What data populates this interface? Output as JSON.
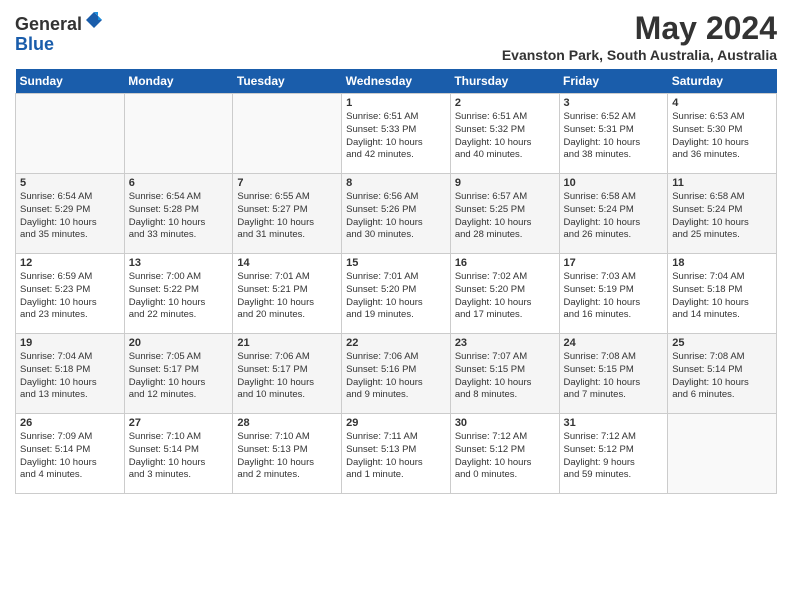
{
  "header": {
    "logo_line1": "General",
    "logo_line2": "Blue",
    "title": "May 2024",
    "subtitle": "Evanston Park, South Australia, Australia"
  },
  "days_of_week": [
    "Sunday",
    "Monday",
    "Tuesday",
    "Wednesday",
    "Thursday",
    "Friday",
    "Saturday"
  ],
  "weeks": [
    [
      {
        "day": "",
        "info": ""
      },
      {
        "day": "",
        "info": ""
      },
      {
        "day": "",
        "info": ""
      },
      {
        "day": "1",
        "info": "Sunrise: 6:51 AM\nSunset: 5:33 PM\nDaylight: 10 hours\nand 42 minutes."
      },
      {
        "day": "2",
        "info": "Sunrise: 6:51 AM\nSunset: 5:32 PM\nDaylight: 10 hours\nand 40 minutes."
      },
      {
        "day": "3",
        "info": "Sunrise: 6:52 AM\nSunset: 5:31 PM\nDaylight: 10 hours\nand 38 minutes."
      },
      {
        "day": "4",
        "info": "Sunrise: 6:53 AM\nSunset: 5:30 PM\nDaylight: 10 hours\nand 36 minutes."
      }
    ],
    [
      {
        "day": "5",
        "info": "Sunrise: 6:54 AM\nSunset: 5:29 PM\nDaylight: 10 hours\nand 35 minutes."
      },
      {
        "day": "6",
        "info": "Sunrise: 6:54 AM\nSunset: 5:28 PM\nDaylight: 10 hours\nand 33 minutes."
      },
      {
        "day": "7",
        "info": "Sunrise: 6:55 AM\nSunset: 5:27 PM\nDaylight: 10 hours\nand 31 minutes."
      },
      {
        "day": "8",
        "info": "Sunrise: 6:56 AM\nSunset: 5:26 PM\nDaylight: 10 hours\nand 30 minutes."
      },
      {
        "day": "9",
        "info": "Sunrise: 6:57 AM\nSunset: 5:25 PM\nDaylight: 10 hours\nand 28 minutes."
      },
      {
        "day": "10",
        "info": "Sunrise: 6:58 AM\nSunset: 5:24 PM\nDaylight: 10 hours\nand 26 minutes."
      },
      {
        "day": "11",
        "info": "Sunrise: 6:58 AM\nSunset: 5:24 PM\nDaylight: 10 hours\nand 25 minutes."
      }
    ],
    [
      {
        "day": "12",
        "info": "Sunrise: 6:59 AM\nSunset: 5:23 PM\nDaylight: 10 hours\nand 23 minutes."
      },
      {
        "day": "13",
        "info": "Sunrise: 7:00 AM\nSunset: 5:22 PM\nDaylight: 10 hours\nand 22 minutes."
      },
      {
        "day": "14",
        "info": "Sunrise: 7:01 AM\nSunset: 5:21 PM\nDaylight: 10 hours\nand 20 minutes."
      },
      {
        "day": "15",
        "info": "Sunrise: 7:01 AM\nSunset: 5:20 PM\nDaylight: 10 hours\nand 19 minutes."
      },
      {
        "day": "16",
        "info": "Sunrise: 7:02 AM\nSunset: 5:20 PM\nDaylight: 10 hours\nand 17 minutes."
      },
      {
        "day": "17",
        "info": "Sunrise: 7:03 AM\nSunset: 5:19 PM\nDaylight: 10 hours\nand 16 minutes."
      },
      {
        "day": "18",
        "info": "Sunrise: 7:04 AM\nSunset: 5:18 PM\nDaylight: 10 hours\nand 14 minutes."
      }
    ],
    [
      {
        "day": "19",
        "info": "Sunrise: 7:04 AM\nSunset: 5:18 PM\nDaylight: 10 hours\nand 13 minutes."
      },
      {
        "day": "20",
        "info": "Sunrise: 7:05 AM\nSunset: 5:17 PM\nDaylight: 10 hours\nand 12 minutes."
      },
      {
        "day": "21",
        "info": "Sunrise: 7:06 AM\nSunset: 5:17 PM\nDaylight: 10 hours\nand 10 minutes."
      },
      {
        "day": "22",
        "info": "Sunrise: 7:06 AM\nSunset: 5:16 PM\nDaylight: 10 hours\nand 9 minutes."
      },
      {
        "day": "23",
        "info": "Sunrise: 7:07 AM\nSunset: 5:15 PM\nDaylight: 10 hours\nand 8 minutes."
      },
      {
        "day": "24",
        "info": "Sunrise: 7:08 AM\nSunset: 5:15 PM\nDaylight: 10 hours\nand 7 minutes."
      },
      {
        "day": "25",
        "info": "Sunrise: 7:08 AM\nSunset: 5:14 PM\nDaylight: 10 hours\nand 6 minutes."
      }
    ],
    [
      {
        "day": "26",
        "info": "Sunrise: 7:09 AM\nSunset: 5:14 PM\nDaylight: 10 hours\nand 4 minutes."
      },
      {
        "day": "27",
        "info": "Sunrise: 7:10 AM\nSunset: 5:14 PM\nDaylight: 10 hours\nand 3 minutes."
      },
      {
        "day": "28",
        "info": "Sunrise: 7:10 AM\nSunset: 5:13 PM\nDaylight: 10 hours\nand 2 minutes."
      },
      {
        "day": "29",
        "info": "Sunrise: 7:11 AM\nSunset: 5:13 PM\nDaylight: 10 hours\nand 1 minute."
      },
      {
        "day": "30",
        "info": "Sunrise: 7:12 AM\nSunset: 5:12 PM\nDaylight: 10 hours\nand 0 minutes."
      },
      {
        "day": "31",
        "info": "Sunrise: 7:12 AM\nSunset: 5:12 PM\nDaylight: 9 hours\nand 59 minutes."
      },
      {
        "day": "",
        "info": ""
      }
    ]
  ]
}
